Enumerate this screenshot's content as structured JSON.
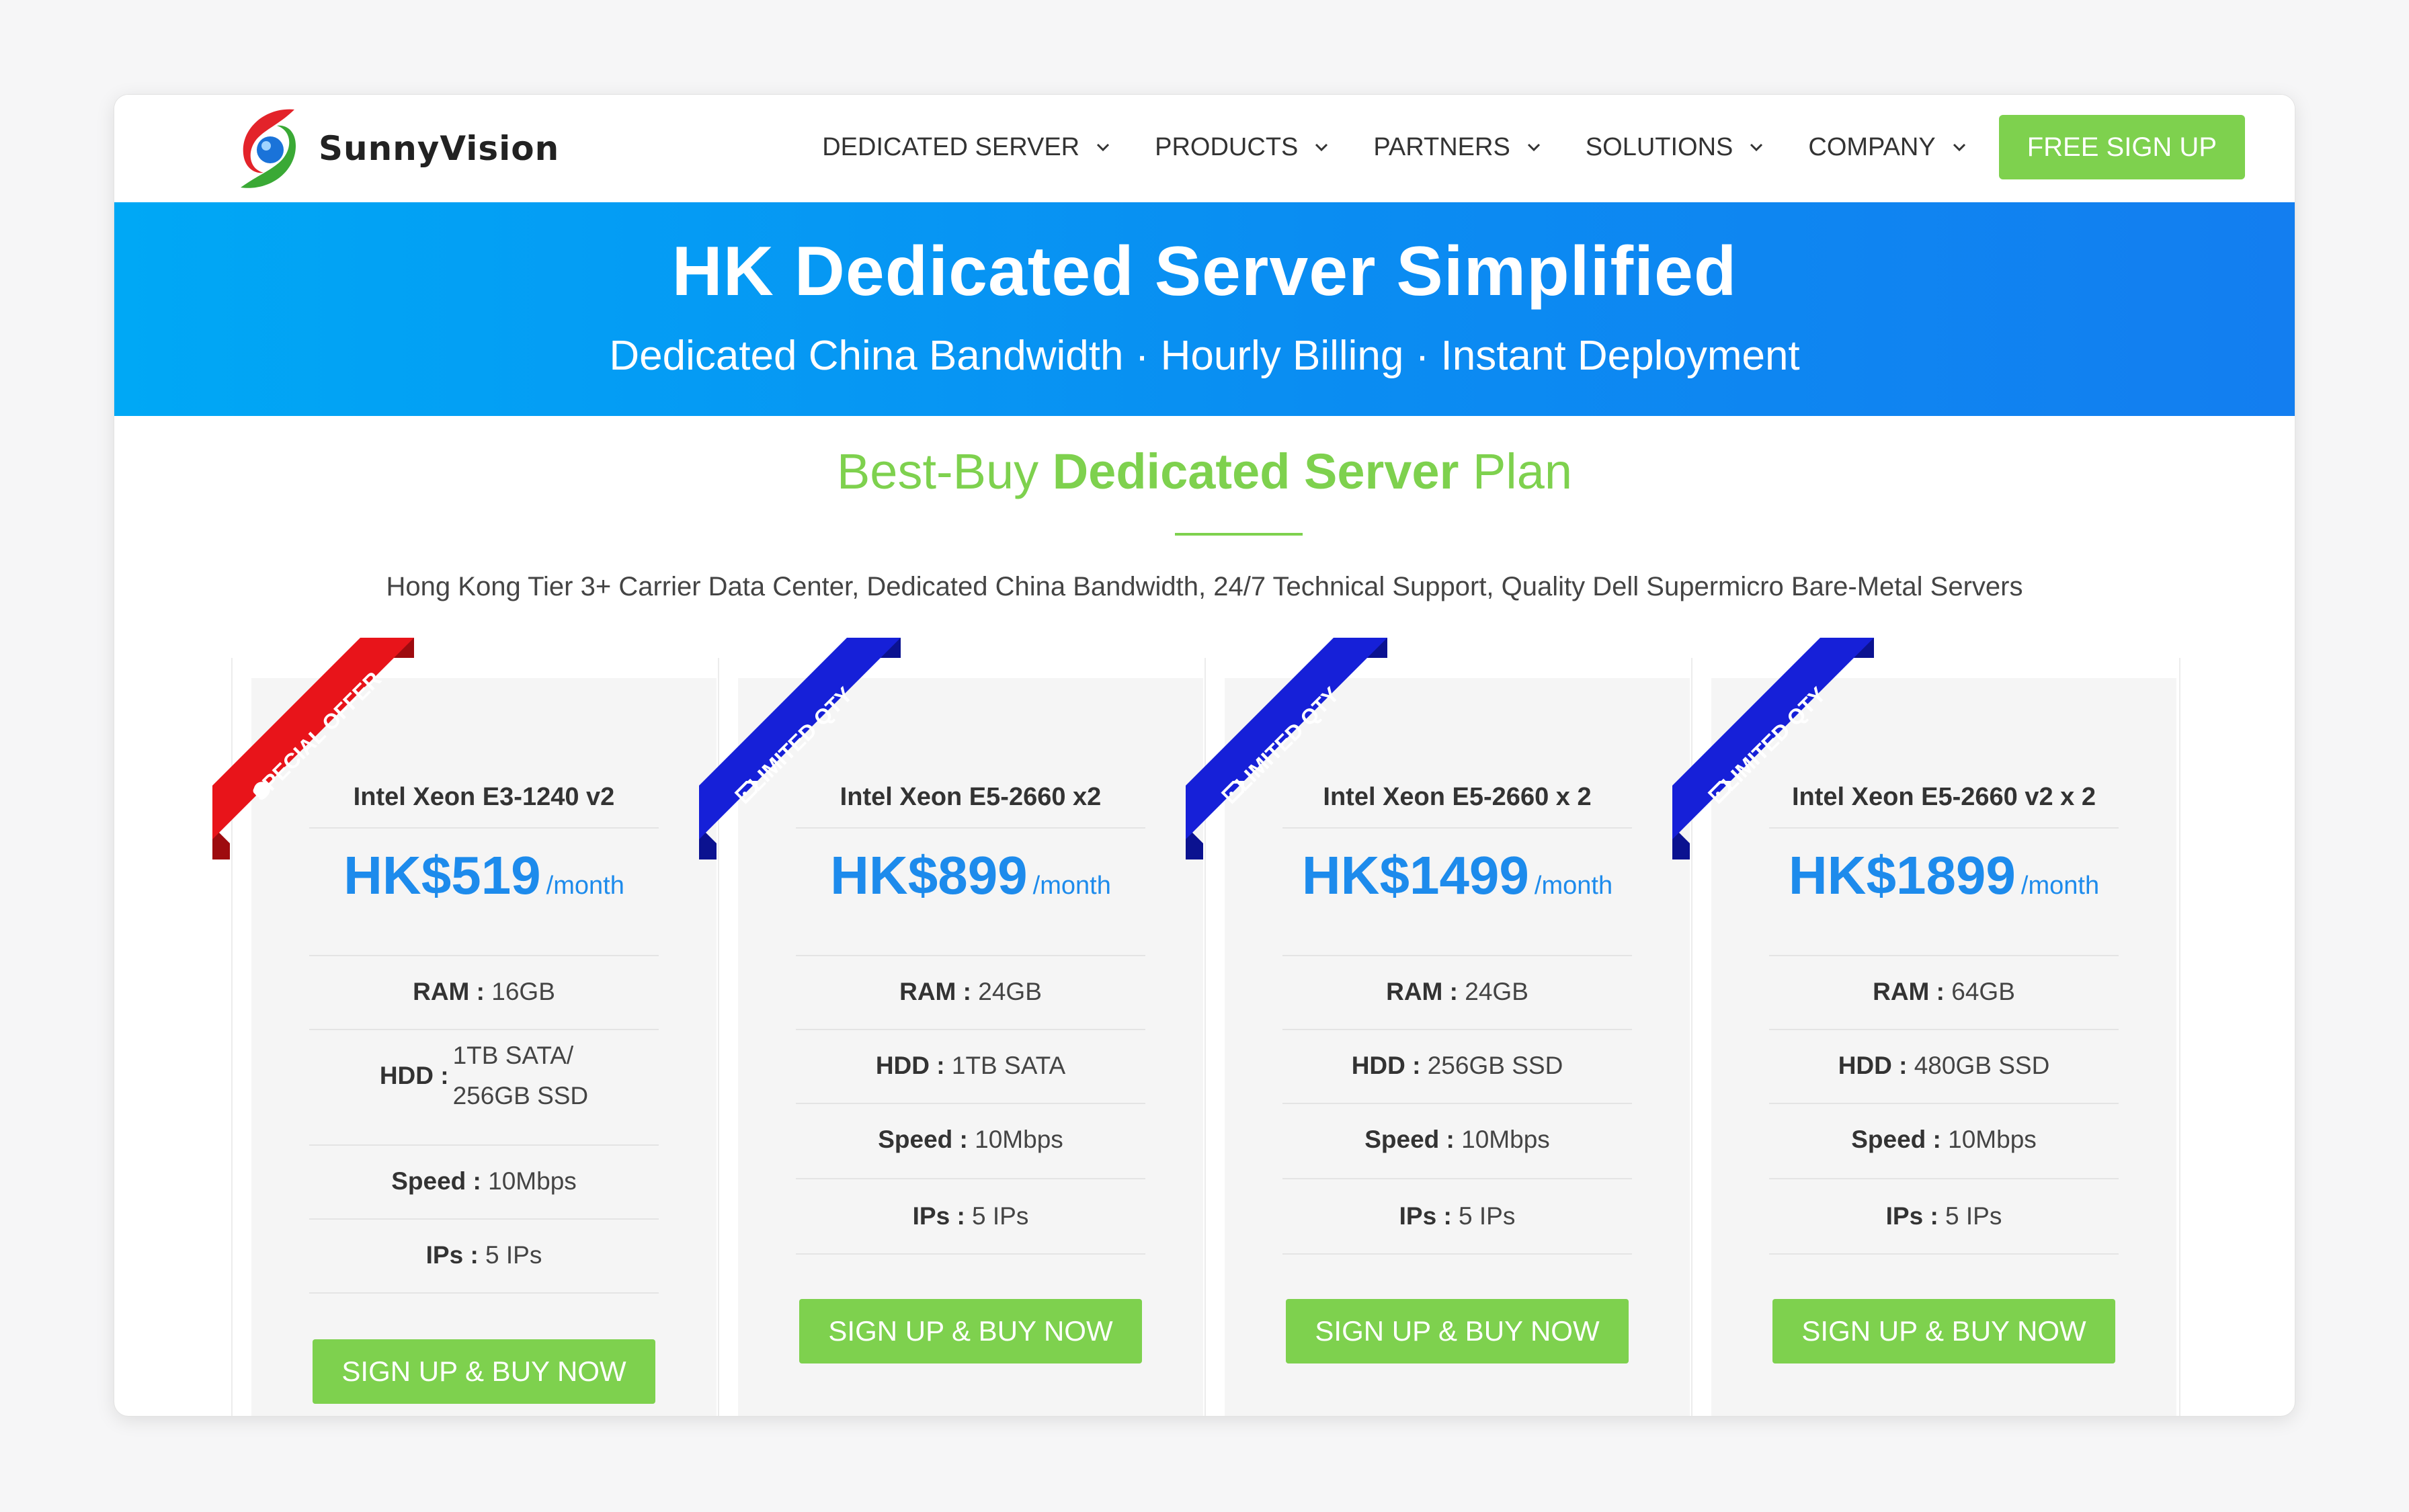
{
  "header": {
    "logo_text": "SunnyVision",
    "nav": [
      {
        "label": "DEDICATED SERVER"
      },
      {
        "label": "PRODUCTS"
      },
      {
        "label": "PARTNERS"
      },
      {
        "label": "SOLUTIONS"
      },
      {
        "label": "COMPANY"
      }
    ],
    "signup_label": "FREE SIGN UP"
  },
  "hero": {
    "title": "HK Dedicated Server Simplified",
    "subtitle": "Dedicated China Bandwidth · Hourly Billing · Instant Deployment"
  },
  "section": {
    "title_pre": "Best-Buy ",
    "title_bold": "Dedicated Server",
    "title_post": " Plan",
    "description": "Hong Kong Tier 3+ Carrier Data Center, Dedicated China Bandwidth, 24/7 Technical Support, Quality Dell Supermicro Bare-Metal Servers"
  },
  "plans": [
    {
      "ribbon": "SPECIAL OFFER",
      "name": "Intel Xeon E3-1240 v2",
      "price": "HK$519",
      "per": "/month",
      "ram_label": "RAM :",
      "ram": "16GB",
      "hdd_label": "HDD :",
      "hdd_line1": "1TB SATA/",
      "hdd_line2": "256GB SSD",
      "speed_label": "Speed :",
      "speed": "10Mbps",
      "ips_label": "IPs :",
      "ips": "5 IPs",
      "button": "SIGN UP & BUY NOW"
    },
    {
      "ribbon": "LIMITED QTY",
      "name": "Intel Xeon E5-2660 x2",
      "price": "HK$899",
      "per": "/month",
      "ram_label": "RAM :",
      "ram": "24GB",
      "hdd_label": "HDD :",
      "hdd": "1TB SATA",
      "speed_label": "Speed :",
      "speed": "10Mbps",
      "ips_label": "IPs :",
      "ips": "5 IPs",
      "button": "SIGN UP & BUY NOW"
    },
    {
      "ribbon": "LIMITED QTY",
      "name": "Intel Xeon E5-2660 x 2",
      "price": "HK$1499",
      "per": "/month",
      "ram_label": "RAM :",
      "ram": "24GB",
      "hdd_label": "HDD :",
      "hdd": "256GB SSD",
      "speed_label": "Speed :",
      "speed": "10Mbps",
      "ips_label": "IPs :",
      "ips": "5 IPs",
      "button": "SIGN UP & BUY NOW"
    },
    {
      "ribbon": "LIMITED QTY",
      "name": "Intel Xeon E5-2660 v2 x 2",
      "price": "HK$1899",
      "per": "/month",
      "ram_label": "RAM :",
      "ram": "64GB",
      "hdd_label": "HDD :",
      "hdd": "480GB SSD",
      "speed_label": "Speed :",
      "speed": "10Mbps",
      "ips_label": "IPs :",
      "ips": "5 IPs",
      "button": "SIGN UP & BUY NOW"
    }
  ],
  "colors": {
    "accent_green": "#7ed14e",
    "price_blue": "#1d8bec",
    "ribbon_red": "#e8141a",
    "ribbon_blue": "#1620d8",
    "hero_start": "#00a8f5",
    "hero_end": "#137ef0"
  },
  "icons": {
    "nav_chevron": "chevron-down-icon",
    "special_ribbon": "badge-icon",
    "limited_ribbon": "tag-icon"
  }
}
